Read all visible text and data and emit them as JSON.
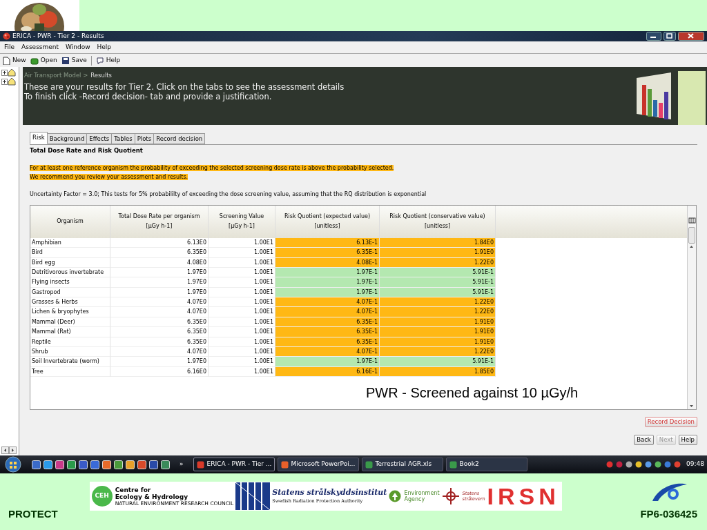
{
  "window": {
    "title": "ERICA - PWR - Tier 2 - Results"
  },
  "menu": [
    "File",
    "Assessment",
    "Window",
    "Help"
  ],
  "toolbar": [
    {
      "kind": "new",
      "label": "New"
    },
    {
      "kind": "open",
      "label": "Open"
    },
    {
      "kind": "save",
      "label": "Save"
    },
    {
      "kind": "help",
      "label": "Help"
    }
  ],
  "header": {
    "breadcrumb": "Air Transport Model >",
    "current": "Results",
    "lines": [
      "These are your results for Tier 2. Click on the tabs to see the assessment details",
      "To finish click -Record decision- tab and provide a justification."
    ]
  },
  "tabs": [
    {
      "label": "Risk",
      "selected": true
    },
    {
      "label": "Background",
      "selected": false
    },
    {
      "label": "Effects",
      "selected": false
    },
    {
      "label": "Tables",
      "selected": false
    },
    {
      "label": "Plots",
      "selected": false
    },
    {
      "label": "Record decision",
      "selected": false
    }
  ],
  "section_title": "Total Dose Rate and Risk Quotient",
  "warning": [
    "For at least one reference organism the probability of exceeding the selected screening dose rate is above the probability selected.",
    "We recommend you review your assessment and results."
  ],
  "uncertainty_note": "Uncertainty Factor = 3.0; This tests for 5% probabililty of exceeding the dose screening value, assuming that the RQ distribution is exponential",
  "table": {
    "columns": [
      [
        "Organism"
      ],
      [
        "Total Dose Rate per organism",
        "[µGy h-1]"
      ],
      [
        "Screening Value",
        "[µGy h-1]"
      ],
      [
        "Risk Quotient (expected value)",
        "[unitless]"
      ],
      [
        "Risk Quotient (conservative value)",
        "[unitless]"
      ]
    ],
    "rows": [
      {
        "organism": "Amphibian",
        "dose": "6.13E0",
        "screening": "1.00E1",
        "rq_expected": "6.13E-1",
        "rq_conservative": "1.84E0",
        "exceeds": true
      },
      {
        "organism": "Bird",
        "dose": "6.35E0",
        "screening": "1.00E1",
        "rq_expected": "6.35E-1",
        "rq_conservative": "1.91E0",
        "exceeds": true
      },
      {
        "organism": "Bird egg",
        "dose": "4.08E0",
        "screening": "1.00E1",
        "rq_expected": "4.08E-1",
        "rq_conservative": "1.22E0",
        "exceeds": true
      },
      {
        "organism": "Detritivorous invertebrate",
        "dose": "1.97E0",
        "screening": "1.00E1",
        "rq_expected": "1.97E-1",
        "rq_conservative": "5.91E-1",
        "exceeds": false
      },
      {
        "organism": "Flying insects",
        "dose": "1.97E0",
        "screening": "1.00E1",
        "rq_expected": "1.97E-1",
        "rq_conservative": "5.91E-1",
        "exceeds": false
      },
      {
        "organism": "Gastropod",
        "dose": "1.97E0",
        "screening": "1.00E1",
        "rq_expected": "1.97E-1",
        "rq_conservative": "5.91E-1",
        "exceeds": false
      },
      {
        "organism": "Grasses & Herbs",
        "dose": "4.07E0",
        "screening": "1.00E1",
        "rq_expected": "4.07E-1",
        "rq_conservative": "1.22E0",
        "exceeds": true
      },
      {
        "organism": "Lichen & bryophytes",
        "dose": "4.07E0",
        "screening": "1.00E1",
        "rq_expected": "4.07E-1",
        "rq_conservative": "1.22E0",
        "exceeds": true
      },
      {
        "organism": "Mammal (Deer)",
        "dose": "6.35E0",
        "screening": "1.00E1",
        "rq_expected": "6.35E-1",
        "rq_conservative": "1.91E0",
        "exceeds": true
      },
      {
        "organism": "Mammal (Rat)",
        "dose": "6.35E0",
        "screening": "1.00E1",
        "rq_expected": "6.35E-1",
        "rq_conservative": "1.91E0",
        "exceeds": true
      },
      {
        "organism": "Reptile",
        "dose": "6.35E0",
        "screening": "1.00E1",
        "rq_expected": "6.35E-1",
        "rq_conservative": "1.91E0",
        "exceeds": true
      },
      {
        "organism": "Shrub",
        "dose": "4.07E0",
        "screening": "1.00E1",
        "rq_expected": "4.07E-1",
        "rq_conservative": "1.22E0",
        "exceeds": true
      },
      {
        "organism": "Soil Invertebrate (worm)",
        "dose": "1.97E0",
        "screening": "1.00E1",
        "rq_expected": "1.97E-1",
        "rq_conservative": "5.91E-1",
        "exceeds": false
      },
      {
        "organism": "Tree",
        "dose": "6.16E0",
        "screening": "1.00E1",
        "rq_expected": "6.16E-1",
        "rq_conservative": "1.85E0",
        "exceeds": true
      }
    ]
  },
  "annotation": "PWR - Screened against 10 µGy/h",
  "record_button": "Record Decision",
  "nav_buttons": [
    {
      "label": "Back",
      "disabled": false
    },
    {
      "label": "Next",
      "disabled": true
    },
    {
      "label": "Help",
      "disabled": false
    }
  ],
  "taskbar": {
    "tasks": [
      {
        "label": "ERICA - PWR - Tier ...",
        "selected": true
      },
      {
        "label": "Microsoft PowerPoi...",
        "selected": false
      },
      {
        "label": "Terrestrial AGR.xls",
        "selected": false
      },
      {
        "label": "Book2",
        "selected": false
      }
    ],
    "overflow": "»",
    "clock": "09:48"
  },
  "footer": {
    "left": "PROTECT",
    "right": "FP6-036425",
    "logos": [
      {
        "kind": "ceh",
        "badge": "CEH",
        "lines": [
          "Centre for",
          "Ecology & Hydrology",
          "NATURAL ENVIRONMENT RESEARCH COUNCIL"
        ]
      },
      {
        "kind": "ssi",
        "lines": [
          "Statens strålskyddsinstitut",
          "Swedish Radiation Protection Authority"
        ]
      },
      {
        "kind": "ea",
        "lines": [
          "Environment",
          "Agency"
        ]
      },
      {
        "kind": "nrpa",
        "lines": [
          "Statens",
          "strålevern"
        ]
      },
      {
        "kind": "irsn",
        "lines": [
          "IRSN"
        ]
      }
    ]
  }
}
